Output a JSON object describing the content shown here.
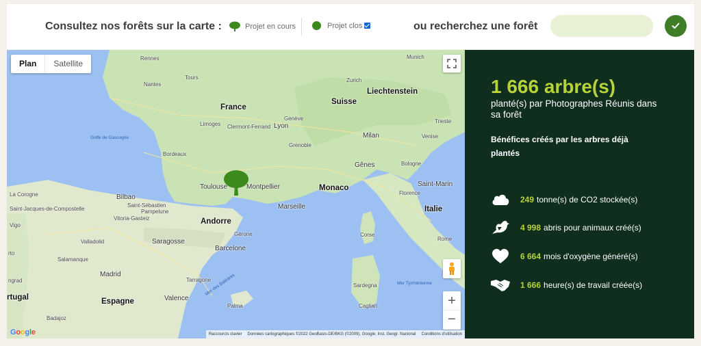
{
  "header": {
    "title": "Consultez nos forêts sur la carte :",
    "legend_current": "Projet en cours",
    "legend_closed": "Projet clos",
    "search_label": "ou recherchez une forêt",
    "search_value": ""
  },
  "map": {
    "type_plan": "Plan",
    "type_satellite": "Satellite",
    "zoom_in": "+",
    "zoom_out": "−",
    "labels": {
      "france": "France",
      "suisse": "Suisse",
      "liechtenstein": "Liechtenstein",
      "munich": "Munich",
      "zurich": "Zurich",
      "rennes": "Rennes",
      "nantes": "Nantes",
      "tours": "Tours",
      "limoges": "Limoges",
      "clermont": "Clermont-Ferrand",
      "lyon": "Lyon",
      "geneve": "Genève",
      "grenoble": "Grenoble",
      "bordeaux": "Bordeaux",
      "toulouse": "Toulouse",
      "montpellier": "Montpellier",
      "monaco": "Monaco",
      "marseille": "Marseille",
      "milan": "Milan",
      "venise": "Venise",
      "trieste": "Trieste",
      "genes": "Gênes",
      "bologne": "Bologne",
      "florence": "Florence",
      "saint_marin": "Saint-Marin",
      "italie": "Italie",
      "corse": "Corse",
      "rome": "Rome",
      "sardegna": "Sardegna",
      "cagliari": "Cagliari",
      "andorre": "Andorre",
      "barcelone": "Barcelone",
      "girone": "Gérone",
      "saragosse": "Saragosse",
      "bilbao": "Bilbao",
      "saint_sebastien": "Saint-Sébastien",
      "vitoria": "Vitoria-Gasteiz",
      "pampelune": "Pampelune",
      "santiago": "Saint-Jacques-de-Compostelle",
      "coruna": "La Corogne",
      "vigo": "Vigo",
      "valladolid": "Valladolid",
      "madrid": "Madrid",
      "espagne": "Espagne",
      "valence": "Valence",
      "palma": "Palma",
      "salamanque": "Salamanque",
      "portugal": "rtugal",
      "badajoz": "Badajoz",
      "tarragone": "Tarragone",
      "golfe": "Golfe de Gascogne",
      "mer_baleares": "Mer des Baléares",
      "mer_tyrrh": "Mer Tyrrhénienne",
      "porto": "rto",
      "ngrad": "ngrad"
    },
    "attribution": {
      "shortcuts": "Raccourcis clavier",
      "data": "Données cartographiques ©2022 GeoBasis-DE/BKG (©2009), Google, Inst. Geogr. Nacional",
      "terms": "Conditions d'utilisation"
    },
    "google": [
      "G",
      "o",
      "o",
      "g",
      "l",
      "e"
    ]
  },
  "panel": {
    "headline": "1 666 arbre(s)",
    "subline": "planté(s) par Photographes Réunis dans sa forêt",
    "benefits_title": "Bénéfices créés par les arbres déjà plantés",
    "stats": [
      {
        "value": "249",
        "text": "tonne(s) de CO2 stockée(s)",
        "icon": "cloud-icon"
      },
      {
        "value": "4 998",
        "text": "abris pour animaux créé(s)",
        "icon": "bird-icon"
      },
      {
        "value": "6 664",
        "text": "mois d'oxygène généré(s)",
        "icon": "heart-icon"
      },
      {
        "value": "1 666",
        "text": "heure(s) de travail créée(s)",
        "icon": "handshake-icon"
      }
    ]
  },
  "colors": {
    "accent": "#b8d33a",
    "panel_bg": "#0f2e1e",
    "button": "#3f7d27",
    "tree_marker": "#3d8a1c"
  }
}
